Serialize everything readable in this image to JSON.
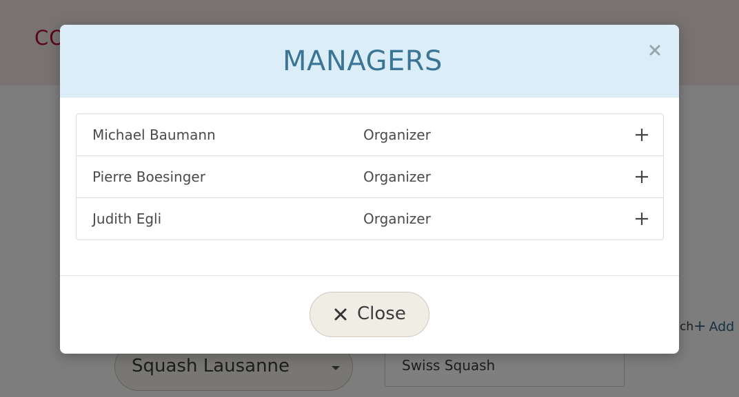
{
  "background": {
    "page_title_fragment": "CO",
    "club_select_value": "Squash Lausanne",
    "federation_value": "Swiss Squash",
    "search_fragment": "ch",
    "add_link_label": "Add"
  },
  "modal": {
    "title": "MANAGERS",
    "close_x_icon": "close-icon",
    "managers": [
      {
        "name": "Michael Baumann",
        "role": "Organizer",
        "action_icon": "plus-icon"
      },
      {
        "name": "Pierre Boesinger",
        "role": "Organizer",
        "action_icon": "plus-icon"
      },
      {
        "name": "Judith Egli",
        "role": "Organizer",
        "action_icon": "plus-icon"
      }
    ],
    "close_button_label": "Close",
    "close_button_icon": "close-icon"
  },
  "colors": {
    "header_bg": "#dbedf7",
    "title_color": "#3a7596",
    "button_bg": "#f0ede5",
    "brand_red": "#b0102a"
  }
}
